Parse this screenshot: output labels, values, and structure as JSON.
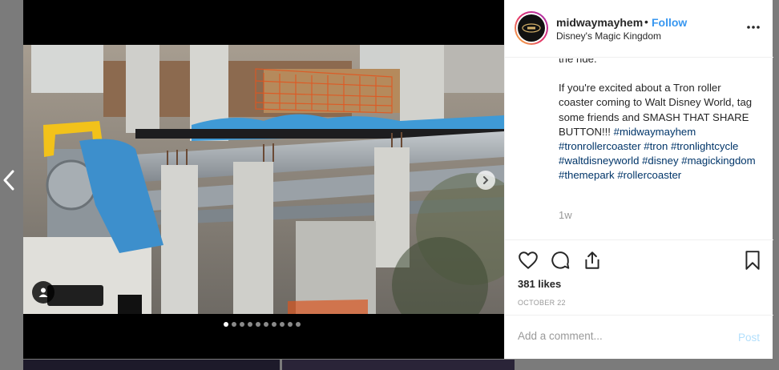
{
  "post": {
    "username": "midwaymayhem",
    "separator": "•",
    "follow_label": "Follow",
    "location": "Disney's Magic Kingdom",
    "caption_lead": "the ride.",
    "caption_body": "If you're excited about a Tron roller coaster coming to Walt Disney World, tag some friends and SMASH THAT SHARE BUTTON!!!",
    "hashtags": [
      "#midwaymayhem",
      "#tronrollercoaster",
      "#tron",
      "#tronlightcycle",
      "#waltdisneyworld",
      "#disney",
      "#magickingdom",
      "#themepark",
      "#rollercoaster"
    ],
    "time_ago": "1w",
    "likes": "381 likes",
    "date": "OCTOBER 22"
  },
  "comment": {
    "placeholder": "Add a comment...",
    "post_label": "Post"
  },
  "carousel": {
    "slide_count": 10,
    "active_index": 0
  },
  "icons": {
    "more": "more-options-icon",
    "like": "heart-icon",
    "comment": "comment-icon",
    "share": "share-icon",
    "save": "bookmark-icon",
    "prev": "chevron-left-icon",
    "next": "chevron-right-icon",
    "tag": "user-tag-icon"
  },
  "colors": {
    "follow": "#3897f0",
    "hashtag": "#003569",
    "muted": "#999999",
    "post_disabled": "#b2dffc"
  }
}
